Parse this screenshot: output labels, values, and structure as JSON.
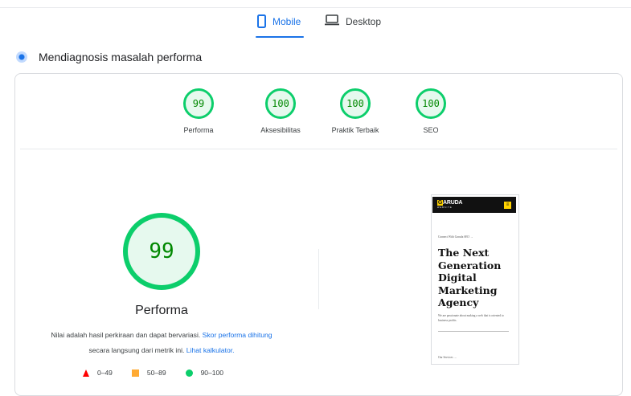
{
  "tabs": [
    {
      "label": "Mobile",
      "icon": "smartphone-icon",
      "active": true
    },
    {
      "label": "Desktop",
      "icon": "laptop-icon",
      "active": false
    }
  ],
  "diagnose": {
    "title": "Mendiagnosis masalah performa",
    "icon": "diagnose-dot-icon"
  },
  "gauges": [
    {
      "score": "99",
      "label": "Performa"
    },
    {
      "score": "100",
      "label": "Aksesibilitas"
    },
    {
      "score": "100",
      "label": "Praktik Terbaik"
    },
    {
      "score": "100",
      "label": "SEO"
    }
  ],
  "performance": {
    "score": "99",
    "title": "Performa",
    "desc_part1": "Nilai adalah hasil perkiraan dan dapat bervariasi.",
    "desc_link1": "Skor performa dihitung",
    "desc_part2": "secara langsung dari metrik ini.",
    "desc_link2": "Lihat kalkulator."
  },
  "legend": [
    {
      "range": "0–49",
      "shape": "triangle",
      "color": "#ff0000"
    },
    {
      "range": "50–89",
      "shape": "square",
      "color": "#ffaa33"
    },
    {
      "range": "90–100",
      "shape": "circle",
      "color": "#0cce6b"
    }
  ],
  "screenshot": {
    "logo_letter": "G",
    "logo_text": "ARUDA",
    "logo_sub": "WEBSITE",
    "menu_icon": "≡",
    "eyebrow": "Connect With Garuda SEO →",
    "headline": "The Next Generation Digital Marketing Agency",
    "body": "We are passionate about making a web that is oriented to business profits.",
    "link": "Our Services →"
  },
  "colors": {
    "accent": "#1a73e8",
    "pass": "#0cce6b",
    "pass_text": "#008800"
  }
}
